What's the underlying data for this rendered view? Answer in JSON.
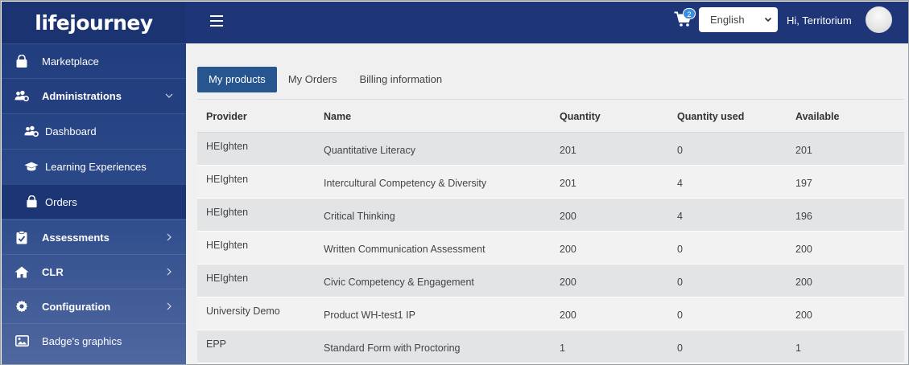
{
  "app": {
    "logo": "lifejourney"
  },
  "sidebar": {
    "items": [
      {
        "label": "Marketplace",
        "icon": "shopping-bag-icon"
      },
      {
        "label": "Administrations",
        "icon": "users-cog-icon"
      },
      {
        "label": "Dashboard",
        "icon": "users-cog-icon"
      },
      {
        "label": "Learning Experiences",
        "icon": "graduation-cap-icon"
      },
      {
        "label": "Orders",
        "icon": "shopping-bag-icon"
      },
      {
        "label": "Assessments",
        "icon": "clipboard-check-icon"
      },
      {
        "label": "CLR",
        "icon": "home-icon"
      },
      {
        "label": "Configuration",
        "icon": "gear-icon"
      },
      {
        "label": "Badge's graphics",
        "icon": "image-icon"
      }
    ]
  },
  "header": {
    "cart_count": "2",
    "language": "English",
    "greeting": "Hi, Territorium"
  },
  "tabs": [
    {
      "label": "My products",
      "active": true
    },
    {
      "label": "My Orders",
      "active": false
    },
    {
      "label": "Billing information",
      "active": false
    }
  ],
  "table": {
    "columns": [
      "Provider",
      "Name",
      "Quantity",
      "Quantity used",
      "Available"
    ],
    "rows": [
      [
        "HEIghten",
        "Quantitative Literacy",
        "201",
        "0",
        "201"
      ],
      [
        "HEIghten",
        "Intercultural Competency & Diversity",
        "201",
        "4",
        "197"
      ],
      [
        "HEIghten",
        "Critical Thinking",
        "200",
        "4",
        "196"
      ],
      [
        "HEIghten",
        "Written Communication Assessment",
        "200",
        "0",
        "200"
      ],
      [
        "HEIghten",
        "Civic Competency & Engagement",
        "200",
        "0",
        "200"
      ],
      [
        "University Demo",
        "Product WH-test1 IP",
        "200",
        "0",
        "200"
      ],
      [
        "EPP",
        "Standard Form with Proctoring",
        "1",
        "0",
        "1"
      ]
    ]
  },
  "colors": {
    "sidebar": "#1f3a7a",
    "topbar": "#1e3678",
    "active_tab": "#27558f",
    "badge": "#3c8dde"
  }
}
